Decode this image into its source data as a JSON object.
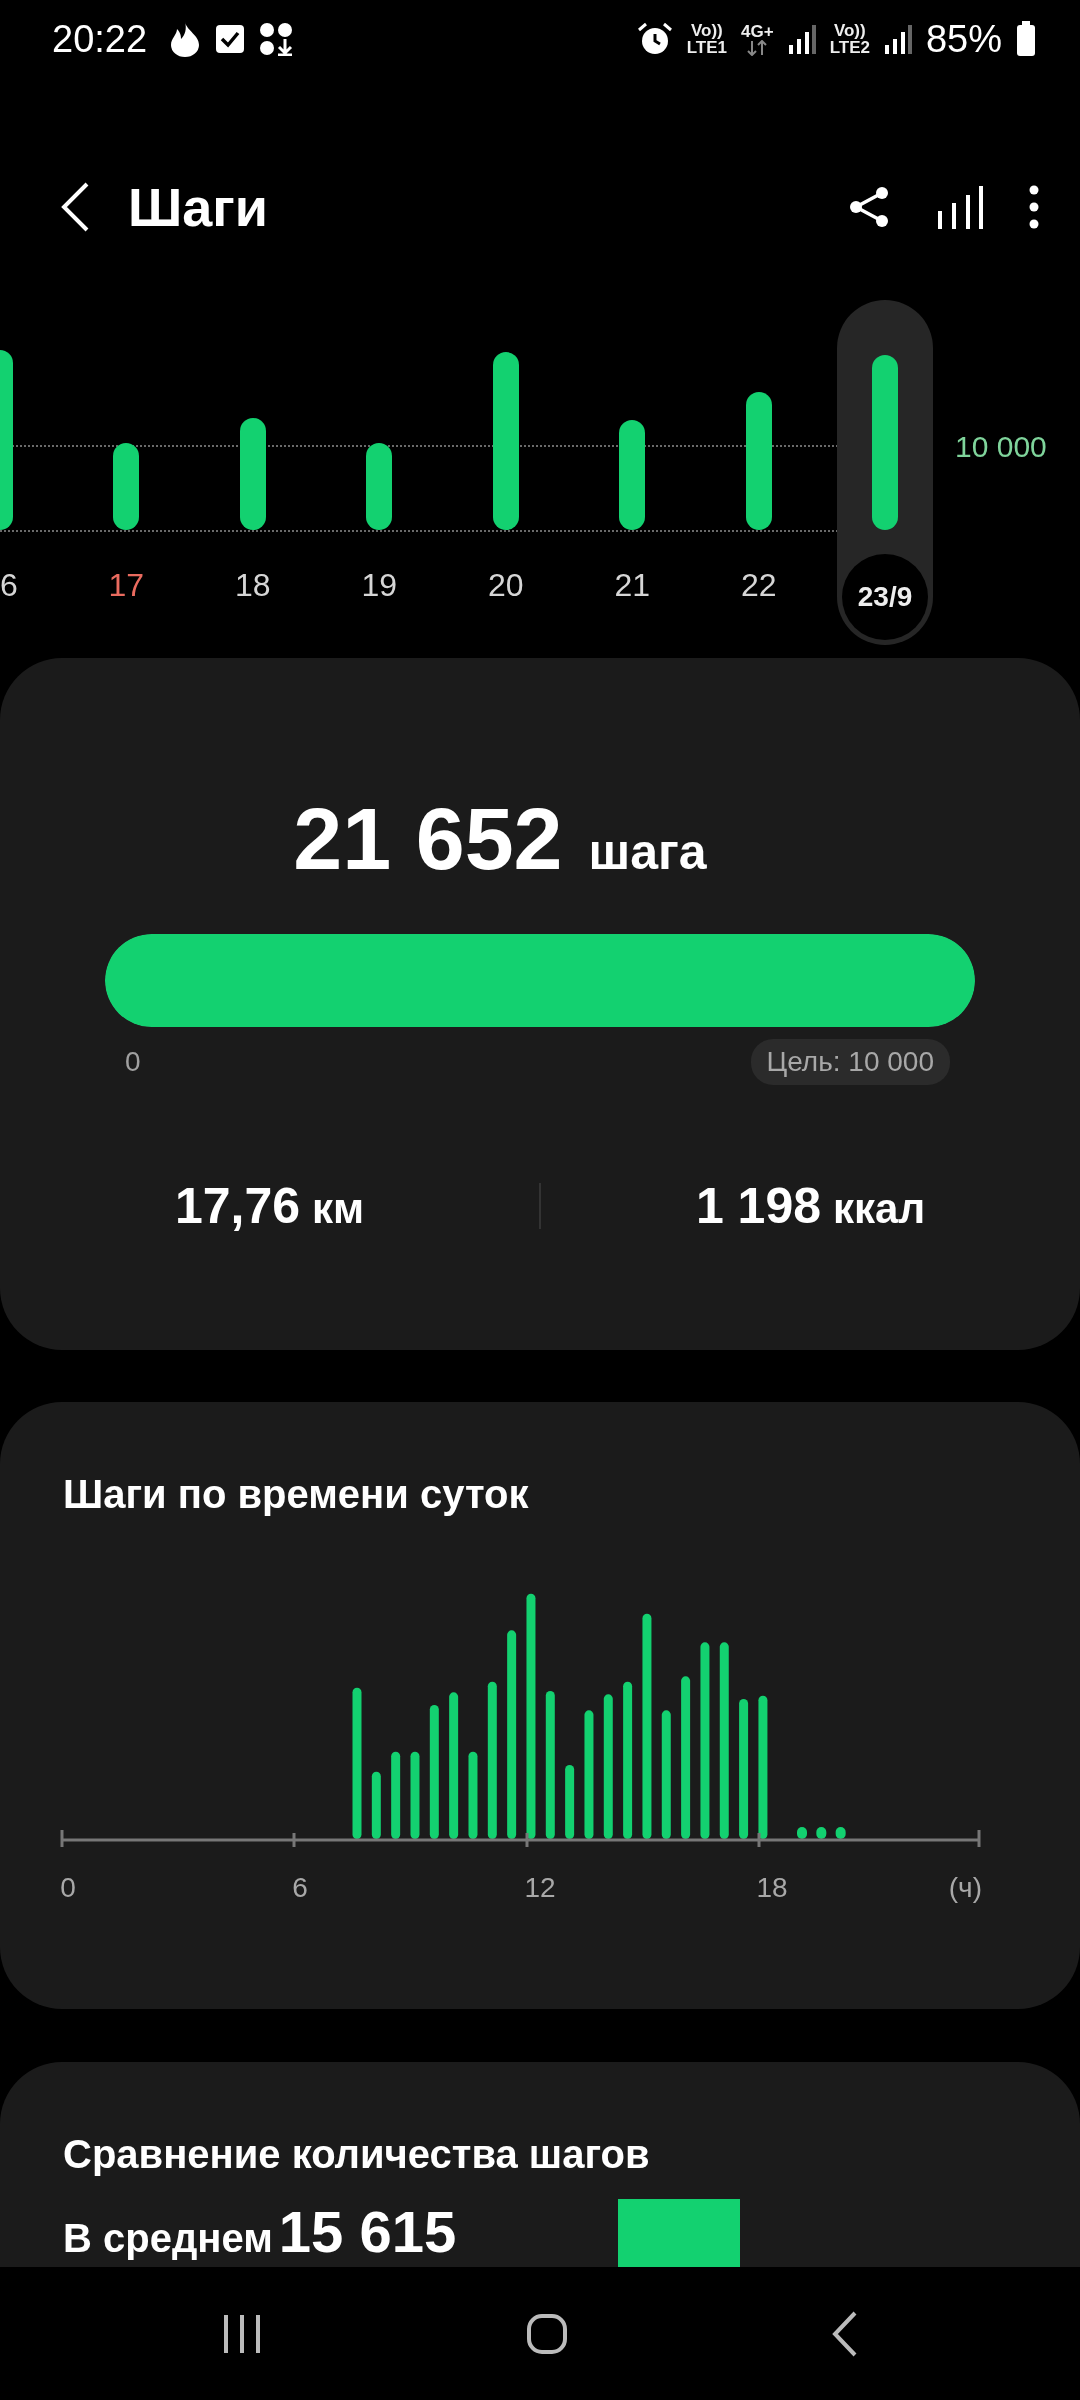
{
  "status_bar": {
    "time": "20:22",
    "sim1": {
      "volte": "Vo))",
      "network": "LTE1"
    },
    "data_type": "4G+",
    "sim2": {
      "volte": "Vo))",
      "network": "LTE2"
    },
    "battery": "85%"
  },
  "header": {
    "title": "Шаги"
  },
  "daily": {
    "goal_label": "10 000",
    "days": [
      {
        "label": "6",
        "selected": false,
        "weekend": false
      },
      {
        "label": "17",
        "selected": false,
        "weekend": true
      },
      {
        "label": "18",
        "selected": false,
        "weekend": false
      },
      {
        "label": "19",
        "selected": false,
        "weekend": false
      },
      {
        "label": "20",
        "selected": false,
        "weekend": false
      },
      {
        "label": "21",
        "selected": false,
        "weekend": false
      },
      {
        "label": "22",
        "selected": false,
        "weekend": false
      },
      {
        "label": "23/9",
        "selected": true,
        "weekend": false
      }
    ]
  },
  "summary": {
    "steps": "21 652",
    "unit": "шага",
    "progress": {
      "level": 1
    },
    "start_label": "0",
    "goal": "Цель: 10 000",
    "distance": {
      "value": "17,76",
      "unit": "км"
    },
    "calories": {
      "value": "1 198",
      "unit": "ккал"
    }
  },
  "hourly": {
    "title": "Шаги по времени суток",
    "axis_labels": [
      "0",
      "6",
      "12",
      "18"
    ],
    "axis_unit": "(ч)"
  },
  "comparison": {
    "title": "Сравнение количества шагов",
    "average_label": "В среднем",
    "average_value": "15 615"
  }
}
